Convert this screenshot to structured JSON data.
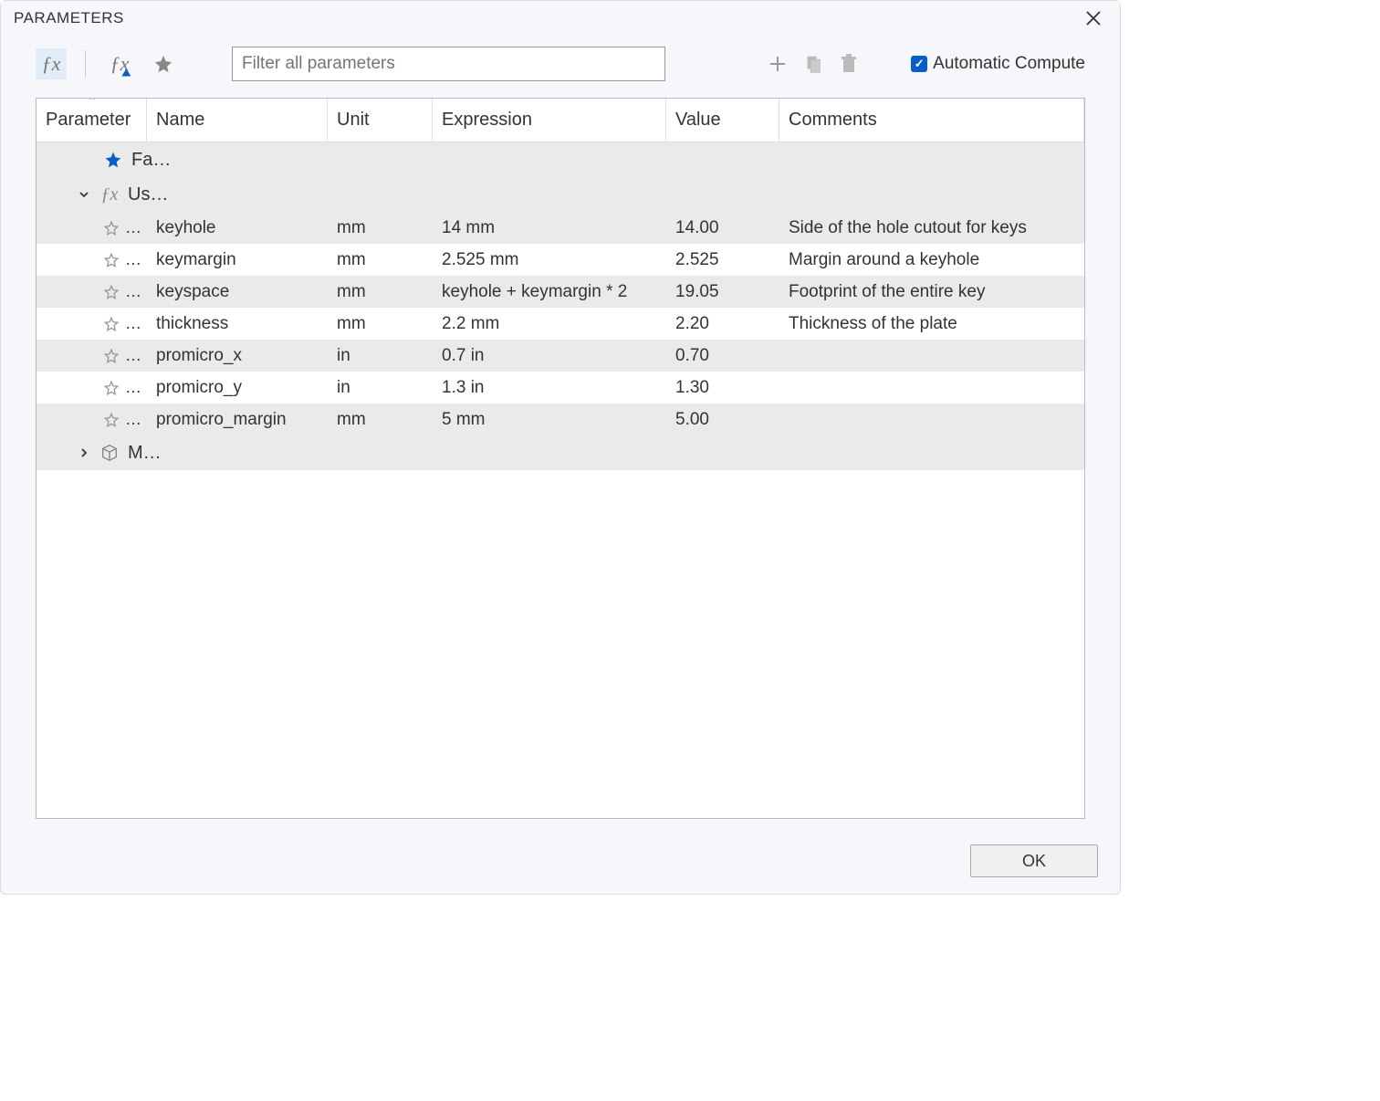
{
  "window": {
    "title": "PARAMETERS"
  },
  "toolbar": {
    "filter_placeholder": "Filter all parameters",
    "auto_compute_label": "Automatic Compute",
    "auto_compute_checked": true
  },
  "table": {
    "headers": {
      "parameter": "Parameter",
      "name": "Name",
      "unit": "Unit",
      "expression": "Expression",
      "value": "Value",
      "comments": "Comments"
    },
    "groups": {
      "favorites": "Fa…",
      "user": "Us…",
      "model": "M…"
    },
    "rows": [
      {
        "name": "keyhole",
        "unit": "mm",
        "expression": "14 mm",
        "value": "14.00",
        "comments": "Side of the hole cutout for keys"
      },
      {
        "name": "keymargin",
        "unit": "mm",
        "expression": "2.525 mm",
        "value": "2.525",
        "comments": "Margin around a keyhole"
      },
      {
        "name": "keyspace",
        "unit": "mm",
        "expression": "keyhole + keymargin * 2",
        "value": "19.05",
        "comments": "Footprint of the entire key"
      },
      {
        "name": "thickness",
        "unit": "mm",
        "expression": "2.2 mm",
        "value": "2.20",
        "comments": "Thickness of the plate"
      },
      {
        "name": "promicro_x",
        "unit": "in",
        "expression": "0.7 in",
        "value": "0.70",
        "comments": ""
      },
      {
        "name": "promicro_y",
        "unit": "in",
        "expression": "1.3 in",
        "value": "1.30",
        "comments": ""
      },
      {
        "name": "promicro_margin",
        "unit": "mm",
        "expression": "5 mm",
        "value": "5.00",
        "comments": ""
      }
    ]
  },
  "footer": {
    "ok_label": "OK"
  }
}
